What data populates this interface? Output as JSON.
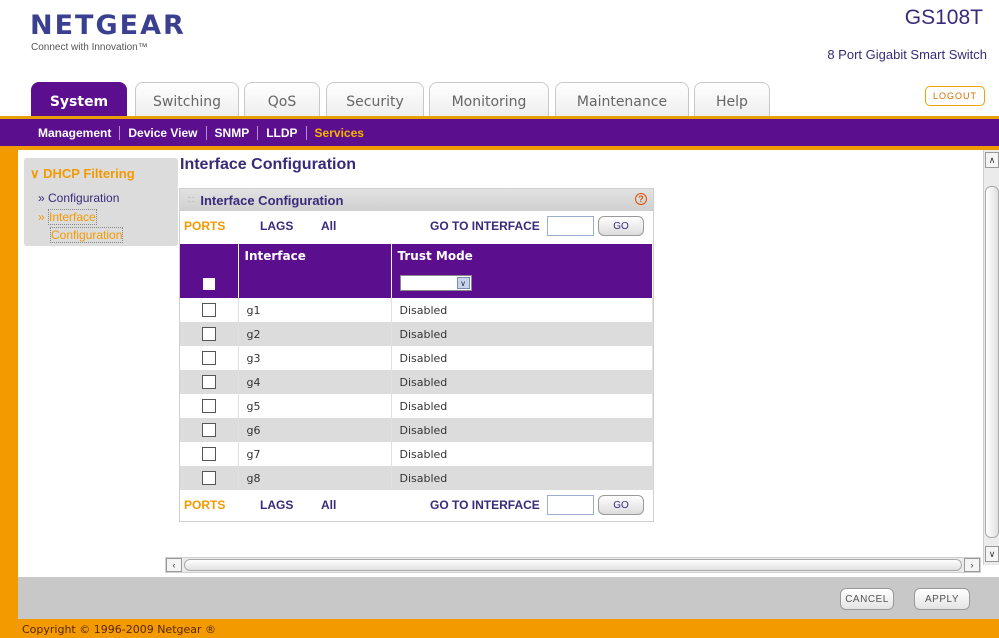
{
  "header": {
    "brand": "NETGEAR",
    "tagline": "Connect with Innovation™",
    "model": "GS108T",
    "model_desc": "8 Port Gigabit Smart Switch",
    "logout_label": "LOGOUT"
  },
  "tabs": [
    {
      "label": "System",
      "active": true
    },
    {
      "label": "Switching"
    },
    {
      "label": "QoS"
    },
    {
      "label": "Security"
    },
    {
      "label": "Monitoring"
    },
    {
      "label": "Maintenance"
    },
    {
      "label": "Help"
    }
  ],
  "subnav": [
    {
      "label": "Management"
    },
    {
      "label": "Device View"
    },
    {
      "label": "SNMP"
    },
    {
      "label": "LLDP"
    },
    {
      "label": "Services",
      "active": true
    }
  ],
  "leftnav": {
    "title": "DHCP Filtering",
    "items": [
      "Configuration",
      "Interface",
      "Configuration"
    ]
  },
  "page_title": "Interface Configuration",
  "panel": {
    "title": "Interface Configuration",
    "help_glyph": "?",
    "links": {
      "ports": "PORTS",
      "lags": "LAGS",
      "all": "All",
      "goto": "GO TO INTERFACE",
      "go": "GO"
    },
    "columns": [
      "Interface",
      "Trust Mode"
    ],
    "rows": [
      {
        "interface": "g1",
        "trust_mode": "Disabled"
      },
      {
        "interface": "g2",
        "trust_mode": "Disabled"
      },
      {
        "interface": "g3",
        "trust_mode": "Disabled"
      },
      {
        "interface": "g4",
        "trust_mode": "Disabled"
      },
      {
        "interface": "g5",
        "trust_mode": "Disabled"
      },
      {
        "interface": "g6",
        "trust_mode": "Disabled"
      },
      {
        "interface": "g7",
        "trust_mode": "Disabled"
      },
      {
        "interface": "g8",
        "trust_mode": "Disabled"
      }
    ]
  },
  "footer": {
    "cancel": "CANCEL",
    "apply": "APPLY",
    "copyright": "Copyright © 1996-2009 Netgear ®"
  }
}
